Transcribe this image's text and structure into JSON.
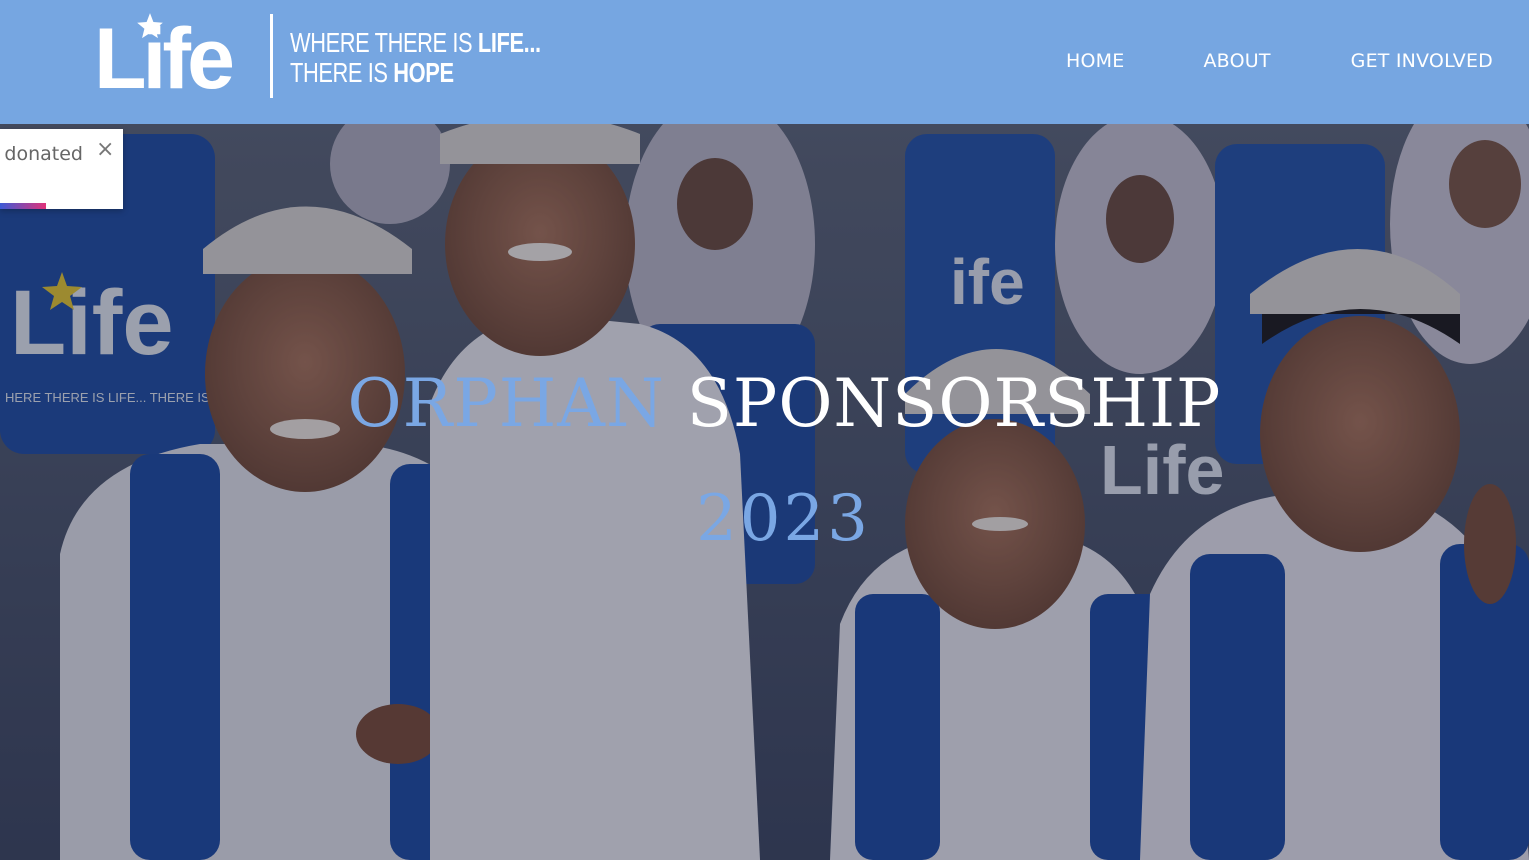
{
  "brand": {
    "wordmark": "Life",
    "tagline_line1_prefix": "WHERE THERE IS ",
    "tagline_line1_bold": "LIFE...",
    "tagline_line2_prefix": "THERE IS ",
    "tagline_line2_bold": "HOPE"
  },
  "nav": {
    "items": [
      {
        "label": "HOME"
      },
      {
        "label": "ABOUT"
      },
      {
        "label": "GET INVOLVED"
      }
    ]
  },
  "hero": {
    "title_part1": "ORPHAN",
    "title_part2": "SPONSORSHIP",
    "year": "2023",
    "background_image": "children-in-white-uniforms-with-blue-life-backpacks"
  },
  "toast": {
    "text": "t donated",
    "close_label": "×",
    "progress": 0.37
  },
  "colors": {
    "header_bg": "#76a6e1",
    "accent_blue": "#7aa7e4",
    "white": "#ffffff"
  }
}
